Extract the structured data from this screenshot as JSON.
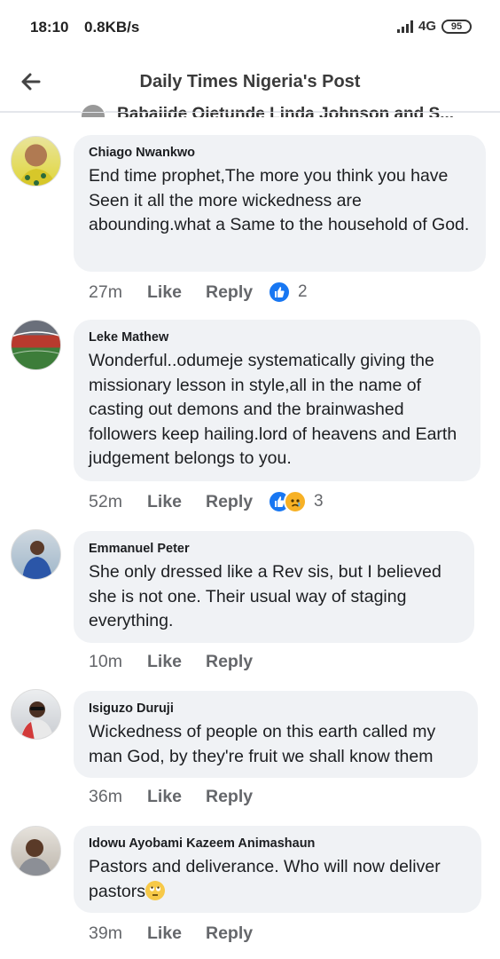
{
  "status_bar": {
    "time": "18:10",
    "speed": "0.8KB/s",
    "network": "4G",
    "battery": "95"
  },
  "nav": {
    "title": "Daily Times Nigeria's Post",
    "partial_text": "Babajide Ojetunde  Linda Johnson and S..."
  },
  "comments": [
    {
      "author": "Chiago Nwankwo",
      "text": "End time prophet,The more you think you have Seen it all the more wickedness are abounding.what a Same to the household of God.",
      "time": "27m",
      "like_label": "Like",
      "reply_label": "Reply",
      "reaction_count": "2",
      "reactions": [
        "like"
      ]
    },
    {
      "author": "Leke Mathew",
      "text": "Wonderful..odumeje systematically giving the missionary lesson in style,all in the name of casting out demons and the brainwashed followers keep hailing.lord of heavens and Earth judgement belongs to you.",
      "time": "52m",
      "like_label": "Like",
      "reply_label": "Reply",
      "reaction_count": "3",
      "reactions": [
        "like",
        "sad"
      ]
    },
    {
      "author": "Emmanuel Peter",
      "text": "She only dressed like a Rev sis, but I believed she is not one. Their usual way of staging everything.",
      "time": "10m",
      "like_label": "Like",
      "reply_label": "Reply"
    },
    {
      "author": "Isiguzo Duruji",
      "text": "Wickedness of people on this earth called my man  God, by they're fruit we shall know them",
      "time": "36m",
      "like_label": "Like",
      "reply_label": "Reply"
    },
    {
      "author": "Idowu Ayobami Kazeem Animashaun",
      "text": "Pastors and deliverance. Who will now deliver pastors",
      "time": "39m",
      "like_label": "Like",
      "reply_label": "Reply",
      "emoji": "face-with-rolling-eyes"
    }
  ],
  "colors": {
    "bubble": "#f0f2f5",
    "secondary_text": "#65676b",
    "like_blue": "#1877f2",
    "sad_yellow": "#f7b125"
  }
}
